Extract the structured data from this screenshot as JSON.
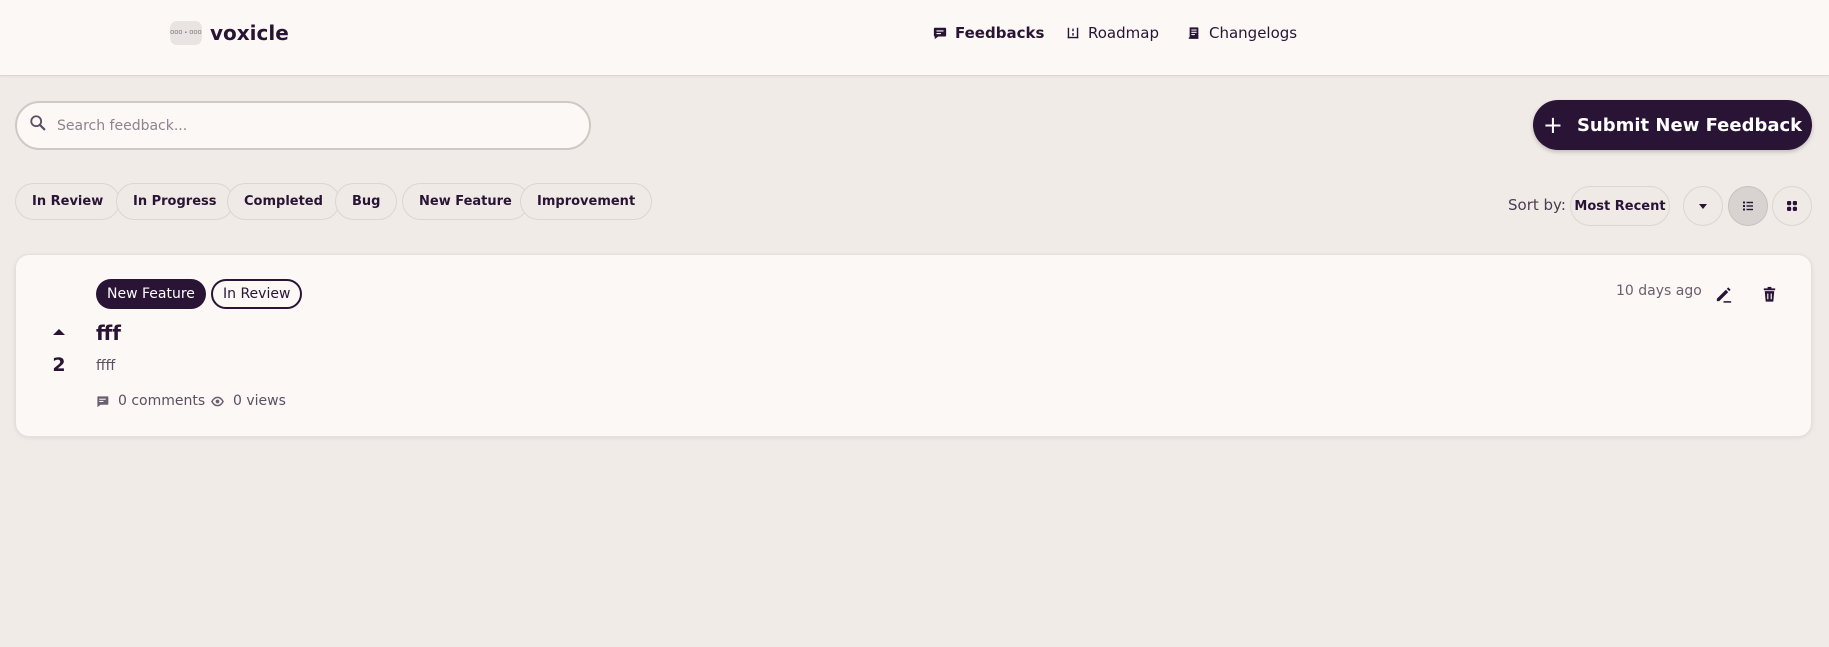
{
  "brand": {
    "logo_text": "OOO • OOO",
    "name": "voxicle"
  },
  "nav": [
    {
      "label": "Feedbacks",
      "icon": "message-icon",
      "active": true
    },
    {
      "label": "Roadmap",
      "icon": "roadmap-icon",
      "active": false
    },
    {
      "label": "Changelogs",
      "icon": "changelog-icon",
      "active": false
    }
  ],
  "search": {
    "placeholder": "Search feedback...",
    "value": ""
  },
  "submit_button": {
    "label": "Submit New Feedback"
  },
  "filters": [
    "In Review",
    "In Progress",
    "Completed",
    "Bug",
    "New Feature",
    "Improvement"
  ],
  "sort": {
    "label": "Sort by:",
    "selected": "Most Recent"
  },
  "view_modes": {
    "list": "list-view-icon",
    "grid": "grid-view-icon",
    "active": "list"
  },
  "feedback": [
    {
      "tags": {
        "category": "New Feature",
        "status": "In Review"
      },
      "title": "fff",
      "description": "ffff",
      "votes": "2",
      "comments": "0 comments",
      "views": "0 views",
      "time": "10 days ago"
    }
  ],
  "colors": {
    "primary": "#2a1436",
    "background": "#f0ebe7",
    "surface": "#fbf8f5"
  }
}
